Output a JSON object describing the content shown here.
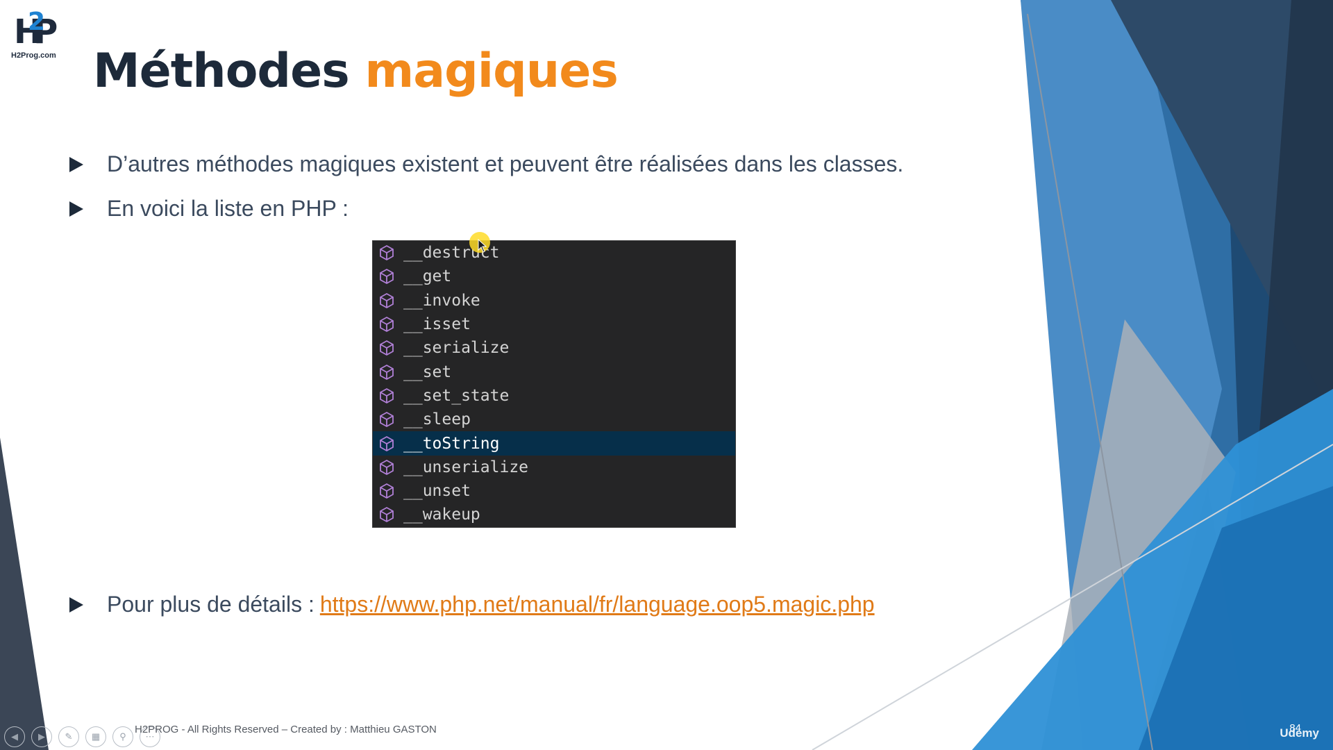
{
  "logo": {
    "caption": "H2Prog.com"
  },
  "slide": {
    "title_part1": "Méthodes",
    "title_part2": "magiques",
    "bullet1": "D’autres méthodes magiques existent et peuvent être réalisées dans les classes.",
    "bullet2": "En voici la liste en PHP :",
    "bullet3_prefix": "Pour plus de détails :",
    "bullet3_link": "https://www.php.net/manual/fr/language.oop5.magic.php"
  },
  "suggestions": {
    "items": [
      {
        "label": "__destruct",
        "selected": false
      },
      {
        "label": "__get",
        "selected": false
      },
      {
        "label": "__invoke",
        "selected": false
      },
      {
        "label": "__isset",
        "selected": false
      },
      {
        "label": "__serialize",
        "selected": false
      },
      {
        "label": "__set",
        "selected": false
      },
      {
        "label": "__set_state",
        "selected": false
      },
      {
        "label": "__sleep",
        "selected": false
      },
      {
        "label": "__toString",
        "selected": true
      },
      {
        "label": "__unserialize",
        "selected": false
      },
      {
        "label": "__unset",
        "selected": false
      },
      {
        "label": "__wakeup",
        "selected": false
      }
    ],
    "icon": "method-cube-icon",
    "icon_color": "#b180d7"
  },
  "footer": {
    "text": "H2PROG - All Rights Reserved – Created by : Matthieu GASTON"
  },
  "page_number": "84",
  "watermark": "Udemy",
  "colors": {
    "title_dark": "#1d2a3a",
    "accent_orange": "#f28a1c",
    "link_orange": "#e07a17",
    "panel_bg": "#252526",
    "selection": "#062f4a"
  }
}
